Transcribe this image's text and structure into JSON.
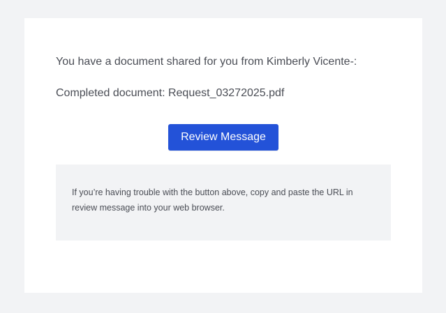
{
  "email": {
    "intro": "You have a document shared for you from Kimberly Vicente-:",
    "document_line": "Completed document: Request_03272025.pdf",
    "button_label": "Review Message",
    "notice_text": "If you’re having trouble with the button above, copy and paste the URL in review message into your web browser."
  },
  "colors": {
    "background": "#f2f3f5",
    "card": "#ffffff",
    "button": "#2352d8",
    "text": "#4a4d55"
  }
}
